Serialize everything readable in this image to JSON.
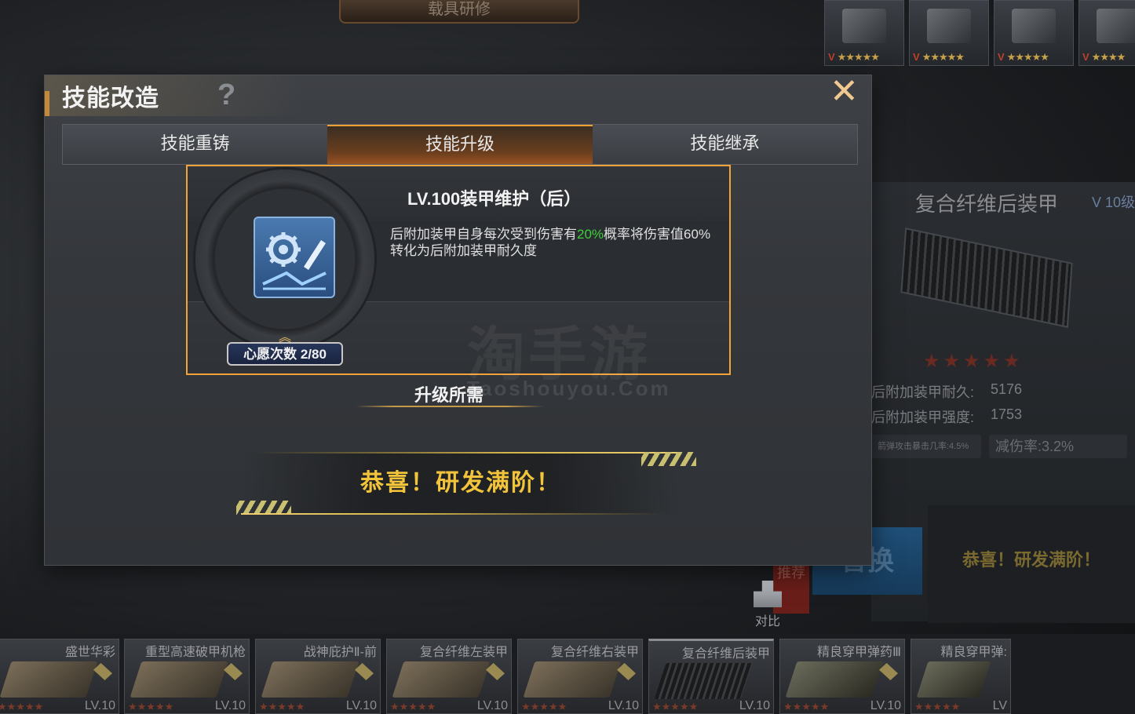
{
  "background": {
    "title": "载具研修",
    "top_items": [
      {
        "prefix": "V",
        "stars": "★★★★★"
      },
      {
        "prefix": "V",
        "stars": "★★★★★"
      },
      {
        "prefix": "V",
        "stars": "★★★★★"
      },
      {
        "prefix": "V",
        "stars": "★★★★"
      }
    ],
    "detail_panel": {
      "name": "复合纤维后装甲",
      "level": "V 10级",
      "stars": "★★★★★",
      "stats": [
        {
          "label": "后附加装甲耐久:",
          "value": "5176"
        },
        {
          "label": "后附加装甲强度:",
          "value": "1753"
        }
      ],
      "chip_left": "箭弹攻击暴击几率:4.5%",
      "chip_right": "减伤率:3.2%",
      "congrats": "恭喜！研发满阶！"
    },
    "recommend_tag": "推荐",
    "replace_button": "替换",
    "compare_label": "对比",
    "bottom_items": [
      {
        "name": "盛世华彩",
        "level": "LV.10",
        "stars": "★★★★★"
      },
      {
        "name": "重型高速破甲机枪",
        "level": "LV.10",
        "stars": "★★★★★"
      },
      {
        "name": "战神庇护Ⅱ-前",
        "level": "LV.10",
        "stars": "★★★★★"
      },
      {
        "name": "复合纤维左装甲",
        "level": "LV.10",
        "stars": "★★★★★"
      },
      {
        "name": "复合纤维右装甲",
        "level": "LV.10",
        "stars": "★★★★★"
      },
      {
        "name": "复合纤维后装甲",
        "level": "LV.10",
        "stars": "★★★★★"
      },
      {
        "name": "精良穿甲弹药Ⅲ",
        "level": "LV.10",
        "stars": "★★★★★"
      },
      {
        "name": "精良穿甲弹:",
        "level": "LV",
        "stars": "★★★★★"
      }
    ]
  },
  "dialog": {
    "title": "技能改造",
    "help_icon": "?",
    "close_icon": "✕",
    "tabs": [
      {
        "label": "技能重铸",
        "active": false
      },
      {
        "label": "技能升级",
        "active": true
      },
      {
        "label": "技能继承",
        "active": false
      }
    ],
    "skill": {
      "name": "LV.100装甲维护（后）",
      "desc_before": "后附加装甲自身每次受到伤害有",
      "desc_highlight": "20%",
      "desc_after": "概率将伤害值60%转化为后附加装甲耐久度",
      "wish_count": "心愿次数 2/80",
      "icon": "wrench-gear-icon"
    },
    "watermark": "淘手游",
    "watermark_en": "Taoshouyou.Com",
    "requirements_title": "升级所需",
    "congrats": "恭喜！研发满阶！"
  },
  "colors": {
    "accent_orange": "#f3a33a",
    "highlight_green": "#3ecf3a",
    "congrats_gold": "#f2c43c"
  }
}
